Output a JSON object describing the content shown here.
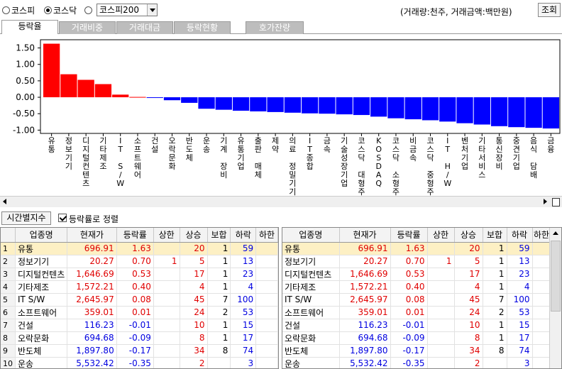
{
  "market_radios": [
    {
      "label": "코스피",
      "checked": false
    },
    {
      "label": "코스닥",
      "checked": true
    },
    {
      "label": "",
      "checked": false
    }
  ],
  "index_select": {
    "value": "코스피200"
  },
  "unit_note": "(거래량:천주, 거래금액:백만원)",
  "view_button": "조회",
  "tabs": [
    "등락율",
    "거래비중",
    "거래대금",
    "등락현황",
    "호가잔량"
  ],
  "time_button": "시간별지수",
  "sort_checkbox": {
    "label": "등락률로 정렬",
    "checked": true
  },
  "colors": {
    "up": "#ff0000",
    "down": "#0000ff",
    "selected_row": "#fdf0c4"
  },
  "chart_data": {
    "type": "bar",
    "ylim": [
      -1.1,
      1.75
    ],
    "yticks": [
      "1.50",
      "1.00",
      "0.50",
      "0.00",
      "-0.50",
      "-1.00"
    ],
    "ytick_values": [
      1.5,
      1.0,
      0.5,
      0.0,
      -0.5,
      -1.0
    ],
    "categories": [
      "유통",
      "정보기기",
      "디지털컨텐츠",
      "기타제조",
      "IT S/W",
      "소프트웨어",
      "건설",
      "오락문화",
      "반도체",
      "운송",
      "기계 장비",
      "유통기업",
      "출판 매체",
      "제약",
      "의료 정밀기기",
      "IT종합",
      "금속",
      "기술성장기업",
      "코스닥 대형주",
      "KOSDAQ",
      "코스닥 소형주",
      "비금속",
      "코스닥 중형주",
      "IT H/W",
      "벤처기업",
      "기타서비스",
      "통신장비",
      "중견기업",
      "음식 담배",
      "금융"
    ],
    "values": [
      1.63,
      0.7,
      0.53,
      0.4,
      0.08,
      0.01,
      -0.01,
      -0.09,
      -0.17,
      -0.35,
      -0.38,
      -0.41,
      -0.43,
      -0.45,
      -0.47,
      -0.49,
      -0.5,
      -0.52,
      -0.54,
      -0.59,
      -0.64,
      -0.67,
      -0.7,
      -0.74,
      -0.79,
      -0.83,
      -0.88,
      -0.91,
      -0.93,
      -0.95
    ]
  },
  "table_headers": [
    "업종명",
    "현재가",
    "등락률",
    "상한",
    "상승",
    "보합",
    "하락",
    "하한"
  ],
  "table_left": [
    {
      "idx": "1",
      "name": "유통",
      "price": "696.91",
      "rate": "1.63",
      "upper": "",
      "up": "20",
      "flat": "1",
      "down": "59",
      "lower": "",
      "sel": true
    },
    {
      "idx": "2",
      "name": "정보기기",
      "price": "20.27",
      "rate": "0.70",
      "upper": "1",
      "up": "5",
      "flat": "1",
      "down": "13",
      "lower": ""
    },
    {
      "idx": "3",
      "name": "디지털컨텐츠",
      "price": "1,646.69",
      "rate": "0.53",
      "upper": "",
      "up": "17",
      "flat": "1",
      "down": "23",
      "lower": ""
    },
    {
      "idx": "4",
      "name": "기타제조",
      "price": "1,572.21",
      "rate": "0.40",
      "upper": "",
      "up": "4",
      "flat": "1",
      "down": "4",
      "lower": ""
    },
    {
      "idx": "5",
      "name": "IT S/W",
      "price": "2,645.97",
      "rate": "0.08",
      "upper": "",
      "up": "45",
      "flat": "7",
      "down": "100",
      "lower": ""
    },
    {
      "idx": "6",
      "name": "소프트웨어",
      "price": "359.01",
      "rate": "0.01",
      "upper": "",
      "up": "24",
      "flat": "2",
      "down": "53",
      "lower": ""
    },
    {
      "idx": "7",
      "name": "건설",
      "price": "116.23",
      "rate": "-0.01",
      "upper": "",
      "up": "10",
      "flat": "1",
      "down": "15",
      "lower": ""
    },
    {
      "idx": "8",
      "name": "오락문화",
      "price": "694.68",
      "rate": "-0.09",
      "upper": "",
      "up": "8",
      "flat": "1",
      "down": "17",
      "lower": ""
    },
    {
      "idx": "9",
      "name": "반도체",
      "price": "1,897.80",
      "rate": "-0.17",
      "upper": "",
      "up": "34",
      "flat": "8",
      "down": "74",
      "lower": ""
    },
    {
      "idx": "10",
      "name": "운송",
      "price": "5,532.42",
      "rate": "-0.35",
      "upper": "",
      "up": "2",
      "flat": "",
      "down": "3",
      "lower": ""
    }
  ],
  "table_right": [
    {
      "name": "유통",
      "price": "696.91",
      "rate": "1.63",
      "upper": "",
      "up": "20",
      "flat": "1",
      "down": "59",
      "lower": "",
      "sel": true
    },
    {
      "name": "정보기기",
      "price": "20.27",
      "rate": "0.70",
      "upper": "1",
      "up": "5",
      "flat": "1",
      "down": "13",
      "lower": ""
    },
    {
      "name": "디지털컨텐츠",
      "price": "1,646.69",
      "rate": "0.53",
      "upper": "",
      "up": "17",
      "flat": "1",
      "down": "23",
      "lower": ""
    },
    {
      "name": "기타제조",
      "price": "1,572.21",
      "rate": "0.40",
      "upper": "",
      "up": "4",
      "flat": "1",
      "down": "4",
      "lower": ""
    },
    {
      "name": "IT S/W",
      "price": "2,645.97",
      "rate": "0.08",
      "upper": "",
      "up": "45",
      "flat": "7",
      "down": "100",
      "lower": ""
    },
    {
      "name": "소프트웨어",
      "price": "359.01",
      "rate": "0.01",
      "upper": "",
      "up": "24",
      "flat": "2",
      "down": "53",
      "lower": ""
    },
    {
      "name": "건설",
      "price": "116.23",
      "rate": "-0.01",
      "upper": "",
      "up": "10",
      "flat": "1",
      "down": "15",
      "lower": ""
    },
    {
      "name": "오락문화",
      "price": "694.68",
      "rate": "-0.09",
      "upper": "",
      "up": "8",
      "flat": "1",
      "down": "17",
      "lower": ""
    },
    {
      "name": "반도체",
      "price": "1,897.80",
      "rate": "-0.17",
      "upper": "",
      "up": "34",
      "flat": "8",
      "down": "74",
      "lower": ""
    },
    {
      "name": "운송",
      "price": "5,532.42",
      "rate": "-0.35",
      "upper": "",
      "up": "2",
      "flat": "",
      "down": "3",
      "lower": ""
    }
  ]
}
